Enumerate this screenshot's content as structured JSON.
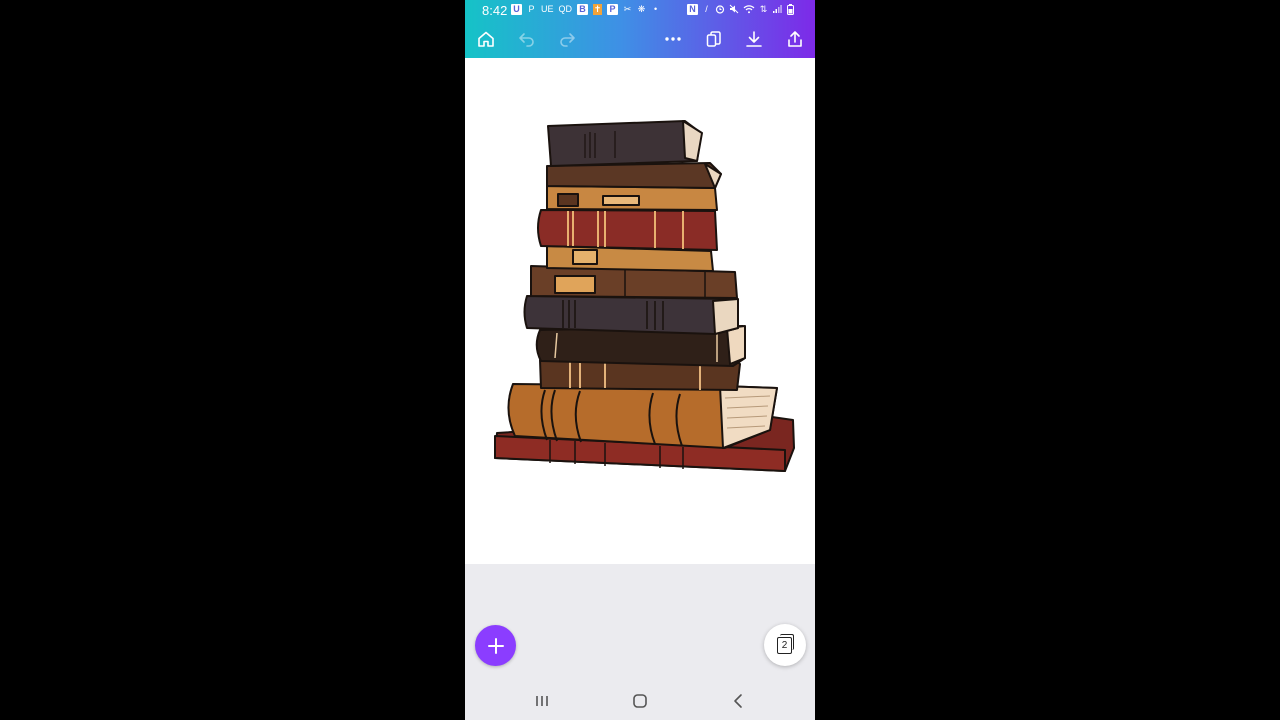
{
  "status_bar": {
    "time": "8:42",
    "left_icons": [
      "U",
      "P",
      "UE",
      "QD",
      "B",
      "✝",
      "P",
      "✂",
      "❋",
      "•"
    ],
    "right_icons": [
      "N",
      "/",
      "⏰",
      "🔇",
      "wifi",
      "⇅",
      "signal",
      "battery"
    ]
  },
  "toolbar": {
    "home": "home-icon",
    "undo": "undo-icon",
    "redo": "redo-icon",
    "more": "more-icon",
    "duplicate": "duplicate-icon",
    "download": "download-icon",
    "share": "share-icon"
  },
  "canvas": {
    "artwork": "stack-of-books-illustration"
  },
  "fab": {
    "icon": "+"
  },
  "pages": {
    "count": "2"
  },
  "colors": {
    "gradient_start": "#15c3c7",
    "gradient_end": "#7d2ae8",
    "fab": "#8b3dff",
    "workspace": "#ebebef"
  }
}
